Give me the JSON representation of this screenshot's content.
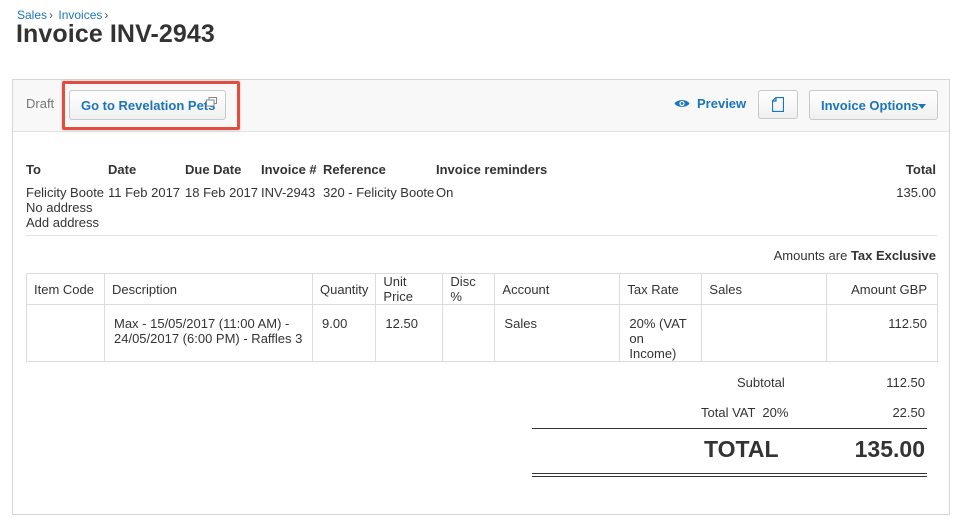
{
  "breadcrumb": {
    "items": [
      "Sales",
      "Invoices"
    ],
    "separator": "›"
  },
  "page_title": "Invoice INV-2943",
  "toolbar": {
    "status": "Draft",
    "goto_label": "Go to Revelation Pets",
    "preview_label": "Preview",
    "options_label": "Invoice Options"
  },
  "invoice": {
    "headers": {
      "to": "To",
      "date": "Date",
      "due_date": "Due Date",
      "invoice_no": "Invoice #",
      "reference": "Reference",
      "reminders": "Invoice reminders",
      "total": "Total"
    },
    "to_name": "Felicity Boote",
    "address": "No address",
    "add_address": "Add address",
    "date": "11 Feb 2017",
    "due_date": "18 Feb 2017",
    "invoice_no": "INV-2943",
    "reference": "320 - Felicity Boote",
    "reminders": "On",
    "total": "135.00"
  },
  "amounts_note": {
    "prefix": "Amounts are",
    "value": "Tax Exclusive"
  },
  "line_items": {
    "columns": [
      "Item Code",
      "Description",
      "Quantity",
      "Unit Price",
      "Disc %",
      "Account",
      "Tax Rate",
      "Sales",
      "Amount GBP"
    ],
    "rows": [
      {
        "item_code": "",
        "description_1": "Max - 15/05/2017 (11:00 AM) -",
        "description_2": "24/05/2017 (6:00 PM) - Raffles 3",
        "quantity": "9.00",
        "unit_price": "12.50",
        "disc": "",
        "account": "Sales",
        "tax_rate_1": "20% (VAT",
        "tax_rate_2": "on Income)",
        "sales": "",
        "amount": "112.50"
      }
    ]
  },
  "summary": {
    "subtotal_label": "Subtotal",
    "subtotal": "112.50",
    "vat_label": "Total VAT  20%",
    "vat": "22.50",
    "total_label": "TOTAL",
    "total": "135.00"
  },
  "colors": {
    "link": "#1b75bb",
    "highlight": "#e24d3e"
  }
}
